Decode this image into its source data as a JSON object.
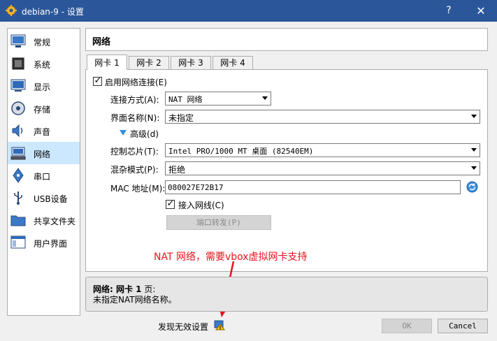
{
  "window": {
    "title": "debian-9 - 设置",
    "help_label": "?",
    "close_label": "✕"
  },
  "sidebar": {
    "items": [
      {
        "label": "常规",
        "icon": "general-icon",
        "active": false
      },
      {
        "label": "系统",
        "icon": "system-icon",
        "active": false
      },
      {
        "label": "显示",
        "icon": "display-icon",
        "active": false
      },
      {
        "label": "存储",
        "icon": "storage-icon",
        "active": false
      },
      {
        "label": "声音",
        "icon": "audio-icon",
        "active": false
      },
      {
        "label": "网络",
        "icon": "network-icon",
        "active": true
      },
      {
        "label": "串口",
        "icon": "serial-port-icon",
        "active": false
      },
      {
        "label": "USB设备",
        "icon": "usb-icon",
        "active": false
      },
      {
        "label": "共享文件夹",
        "icon": "shared-folder-icon",
        "active": false
      },
      {
        "label": "用户界面",
        "icon": "user-interface-icon",
        "active": false
      }
    ]
  },
  "section": {
    "title": "网络"
  },
  "tabs": [
    "网卡 1",
    "网卡 2",
    "网卡 3",
    "网卡 4"
  ],
  "adapter": {
    "enable_label": "启用网络连接(E)",
    "enable_checked": true,
    "attached_label": "连接方式(A):",
    "attached_value": "NAT 网络",
    "name_label": "界面名称(N):",
    "name_value": "未指定",
    "advanced_label": "高级(d)",
    "chip_label": "控制芯片(T):",
    "chip_value": "Intel PRO/1000 MT 桌面 (82540EM)",
    "promisc_label": "混杂模式(P):",
    "promisc_value": "拒绝",
    "mac_label": "MAC 地址(M):",
    "mac_value": "080027E72B17",
    "cable_label": "接入网线(C)",
    "cable_checked": true,
    "port_forward_label": "端口转发(P)"
  },
  "annotation": {
    "text": "NAT 网络，需要vbox虚拟网卡支持"
  },
  "info": {
    "line1_bold": "网络: 网卡 1",
    "line1_rest": " 页:",
    "line2": "未指定NAT网络名称。"
  },
  "footer": {
    "invalid_settings": "发现无效设置",
    "ok_label": "OK",
    "cancel_label": "Cancel"
  },
  "colors": {
    "titlebar": "#2b579a",
    "selection": "#cce8ff",
    "annotation": "#e8131b"
  }
}
